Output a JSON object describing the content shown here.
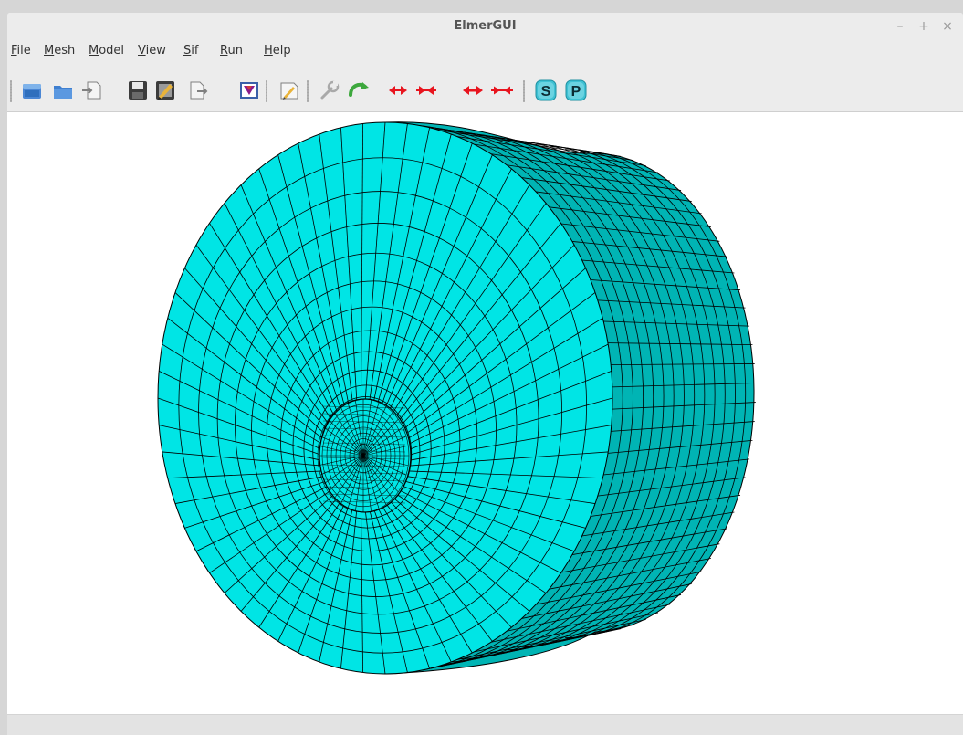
{
  "window": {
    "title": "ElmerGUI",
    "controls": {
      "minimize": "–",
      "maximize": "+",
      "close": "×"
    }
  },
  "menubar": {
    "items": [
      {
        "first": "F",
        "rest": "ile"
      },
      {
        "first": "M",
        "rest": "esh"
      },
      {
        "first": "M",
        "rest": "odel"
      },
      {
        "first": "V",
        "rest": "iew"
      },
      {
        "first": "S",
        "rest": "if"
      },
      {
        "first": "R",
        "rest": "un"
      },
      {
        "first": "H",
        "rest": "elp"
      }
    ]
  },
  "toolbar": {
    "icons": [
      "open-icon",
      "load-icon",
      "import-icon",
      "save-icon",
      "edit-save-icon",
      "export-icon",
      "mesh-view-icon",
      "edit-sif-icon",
      "wrench-icon",
      "rotate-icon",
      "move-left-right-icon",
      "move-in-icon",
      "expand-horizontal-icon",
      "contract-horizontal-icon",
      "solver-icon",
      "postprocessor-icon"
    ],
    "badge_s": "S",
    "badge_p": "P"
  },
  "colors": {
    "mesh_face": "#00e5e5",
    "mesh_side": "#00b4b4",
    "mesh_lines": "#000000",
    "arrows": "#e8141e",
    "badge": "#3ec1d3"
  }
}
